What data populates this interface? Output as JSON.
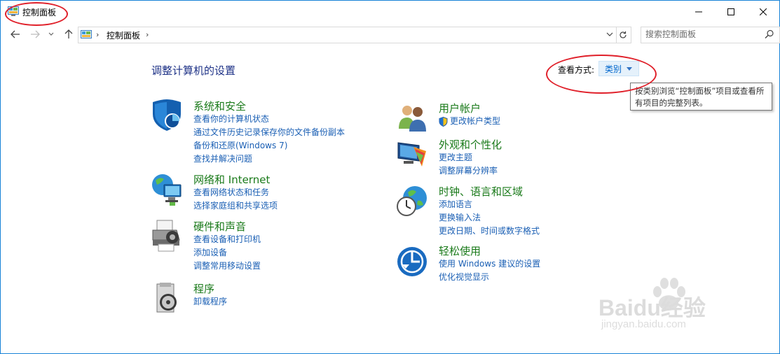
{
  "window": {
    "title": "控制面板",
    "controls": {
      "minimize": "minimize",
      "maximize": "maximize",
      "close": "close"
    }
  },
  "address_bar": {
    "breadcrumb": "控制面板",
    "search_placeholder": "搜索控制面板"
  },
  "main": {
    "title": "调整计算机的设置",
    "view_by_label": "查看方式:",
    "view_by_value": "类别",
    "tooltip": "按类别浏览“控制面板”项目或查看所有项目的完整列表。"
  },
  "categories_left": [
    {
      "title": "系统和安全",
      "links": [
        "查看你的计算机状态",
        "通过文件历史记录保存你的文件备份副本",
        "备份和还原(Windows 7)",
        "查找并解决问题"
      ]
    },
    {
      "title": "网络和 Internet",
      "links": [
        "查看网络状态和任务",
        "选择家庭组和共享选项"
      ]
    },
    {
      "title": "硬件和声音",
      "links": [
        "查看设备和打印机",
        "添加设备",
        "调整常用移动设置"
      ]
    },
    {
      "title": "程序",
      "links": [
        "卸载程序"
      ]
    }
  ],
  "categories_right": [
    {
      "title": "用户帐户",
      "links": [
        "更改帐户类型"
      ]
    },
    {
      "title": "外观和个性化",
      "links": [
        "更改主题",
        "调整屏幕分辨率"
      ]
    },
    {
      "title": "时钟、语言和区域",
      "links": [
        "添加语言",
        "更换输入法",
        "更改日期、时间或数字格式"
      ]
    },
    {
      "title": "轻松使用",
      "links": [
        "使用 Windows 建议的设置",
        "优化视觉显示"
      ]
    }
  ],
  "watermark": {
    "brand": "Baidu经验",
    "url": "jingyan.baidu.com"
  },
  "colors": {
    "link": "#1a5fb4",
    "category_title": "#1a7a1a",
    "page_title": "#1e3287",
    "annotation": "#e0202a",
    "border": "#1883d7"
  }
}
